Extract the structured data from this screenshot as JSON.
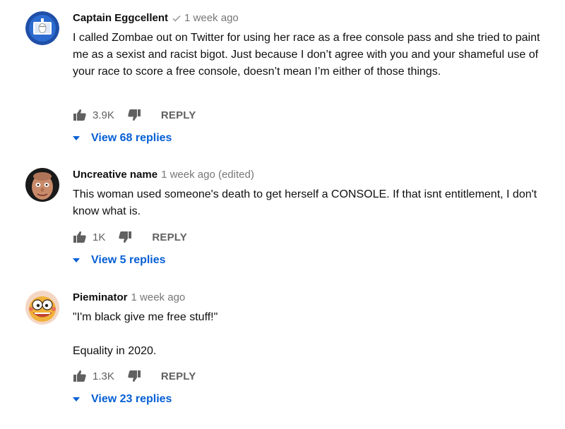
{
  "comments": [
    {
      "author": "Captain Eggcellent",
      "verified": true,
      "time": "1 week ago",
      "paragraphs": [
        "I called Zombae out on Twitter for using her race as a free console pass and she tried to paint me as a sexist and racist bigot. Just because I don’t agree with you and your shameful use of your race to score a free console, doesn’t mean I’m either of those things."
      ],
      "likes": "3.9K",
      "reply_label": "REPLY",
      "view_replies": "View 68 replies",
      "avatar_icon": "egg-logo-avatar"
    },
    {
      "author": "Uncreative name",
      "verified": false,
      "time": "1 week ago (edited)",
      "paragraphs": [
        "This woman used someone's death to get herself a CONSOLE. If that isnt entitlement, I don't know what is."
      ],
      "likes": "1K",
      "reply_label": "REPLY",
      "view_replies": "View 5 replies",
      "avatar_icon": "cartoon-face-avatar"
    },
    {
      "author": "Pieminator",
      "verified": false,
      "time": "1 week ago",
      "paragraphs": [
        "\"I'm black give me free stuff!\"",
        "",
        "Equality in 2020."
      ],
      "likes": "1.3K",
      "reply_label": "REPLY",
      "view_replies": "View 23 replies",
      "avatar_icon": "cartoon-character-avatar"
    }
  ],
  "colors": {
    "link": "#065fd4",
    "secondary_text": "#606060",
    "meta_text": "#777777"
  }
}
